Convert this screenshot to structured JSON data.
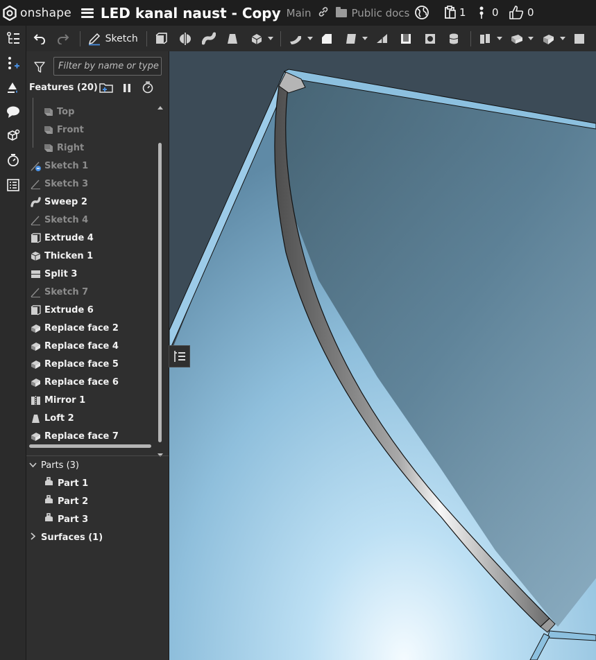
{
  "app": {
    "logo_text": "onshape",
    "document_title": "LED kanal naust - Copy",
    "branch": "Main",
    "folder": "Public docs",
    "versions_count": "1",
    "branches_count": "0",
    "likes_count": "0"
  },
  "toolbar": {
    "sketch_label": "Sketch"
  },
  "feature_panel": {
    "filter_placeholder": "Filter by name or type",
    "header": "Features (20)",
    "features": [
      {
        "label": "Top",
        "icon": "plane-icon",
        "dim": true
      },
      {
        "label": "Front",
        "icon": "plane-icon",
        "dim": true
      },
      {
        "label": "Right",
        "icon": "plane-icon",
        "dim": true
      },
      {
        "label": "Sketch 1",
        "icon": "sketch-icon",
        "dim": true
      },
      {
        "label": "Sketch 3",
        "icon": "sketch-icon",
        "dim": true
      },
      {
        "label": "Sweep 2",
        "icon": "sweep-icon",
        "dim": false
      },
      {
        "label": "Sketch 4",
        "icon": "sketch-icon",
        "dim": true
      },
      {
        "label": "Extrude 4",
        "icon": "extrude-icon",
        "dim": false
      },
      {
        "label": "Thicken 1",
        "icon": "thicken-icon",
        "dim": false
      },
      {
        "label": "Split 3",
        "icon": "split-icon",
        "dim": false
      },
      {
        "label": "Sketch 7",
        "icon": "sketch-icon",
        "dim": true
      },
      {
        "label": "Extrude 6",
        "icon": "extrude-icon",
        "dim": false
      },
      {
        "label": "Replace face 2",
        "icon": "replace-face-icon",
        "dim": false
      },
      {
        "label": "Replace face 4",
        "icon": "replace-face-icon",
        "dim": false
      },
      {
        "label": "Replace face 5",
        "icon": "replace-face-icon",
        "dim": false
      },
      {
        "label": "Replace face 6",
        "icon": "replace-face-icon",
        "dim": false
      },
      {
        "label": "Mirror 1",
        "icon": "mirror-icon",
        "dim": false
      },
      {
        "label": "Loft 2",
        "icon": "loft-icon",
        "dim": false
      },
      {
        "label": "Replace face 7",
        "icon": "replace-face-icon",
        "dim": false
      }
    ],
    "parts_header": "Parts (3)",
    "parts": [
      "Part 1",
      "Part 2",
      "Part 3"
    ],
    "surfaces_header": "Surfaces (1)"
  },
  "colors": {
    "background": "#2b2b2b",
    "accent": "#4a90e2",
    "model_blue": "#8ec3e6"
  }
}
